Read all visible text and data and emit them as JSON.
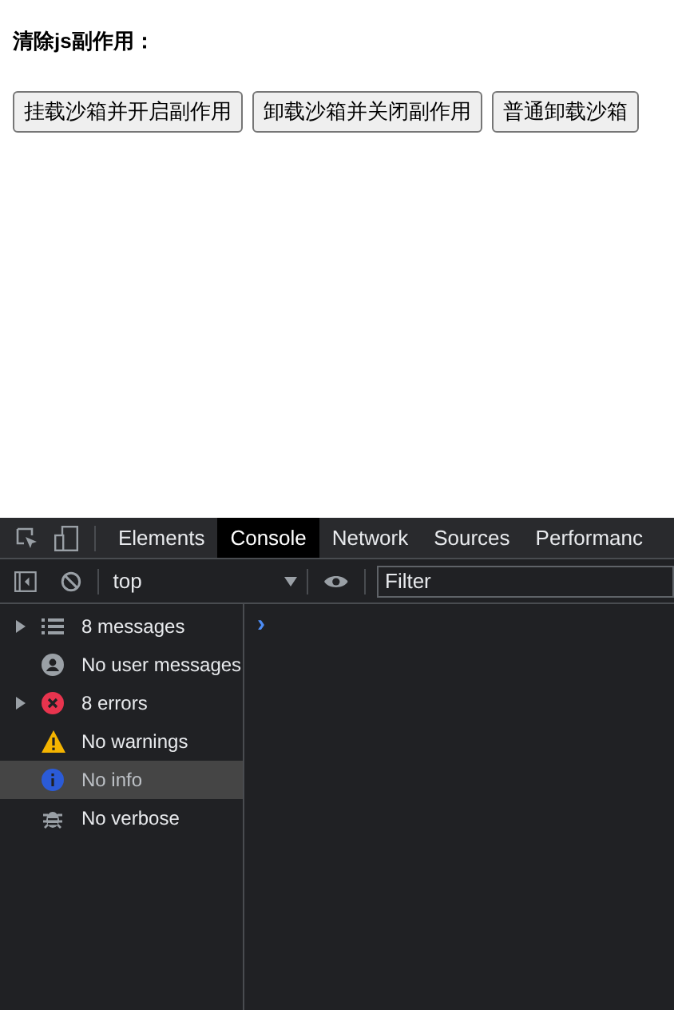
{
  "page": {
    "heading": "清除js副作用：",
    "buttons": [
      "挂载沙箱并开启副作用",
      "卸载沙箱并关闭副作用",
      "普通卸载沙箱"
    ]
  },
  "devtools": {
    "tabs": [
      {
        "label": "Elements",
        "selected": false
      },
      {
        "label": "Console",
        "selected": true
      },
      {
        "label": "Network",
        "selected": false
      },
      {
        "label": "Sources",
        "selected": false
      },
      {
        "label": "Performanc",
        "selected": false
      }
    ],
    "context": "top",
    "filter": {
      "placeholder": "Filter"
    },
    "sidebar": [
      {
        "kind": "messages",
        "label": "8 messages",
        "expandable": true,
        "selected": false
      },
      {
        "kind": "user",
        "label": "No user messages",
        "expandable": false,
        "selected": false
      },
      {
        "kind": "errors",
        "label": "8 errors",
        "expandable": true,
        "selected": false
      },
      {
        "kind": "warnings",
        "label": "No warnings",
        "expandable": false,
        "selected": false
      },
      {
        "kind": "info",
        "label": "No info",
        "expandable": false,
        "selected": true
      },
      {
        "kind": "verbose",
        "label": "No verbose",
        "expandable": false,
        "selected": false
      }
    ],
    "prompt": "›"
  }
}
